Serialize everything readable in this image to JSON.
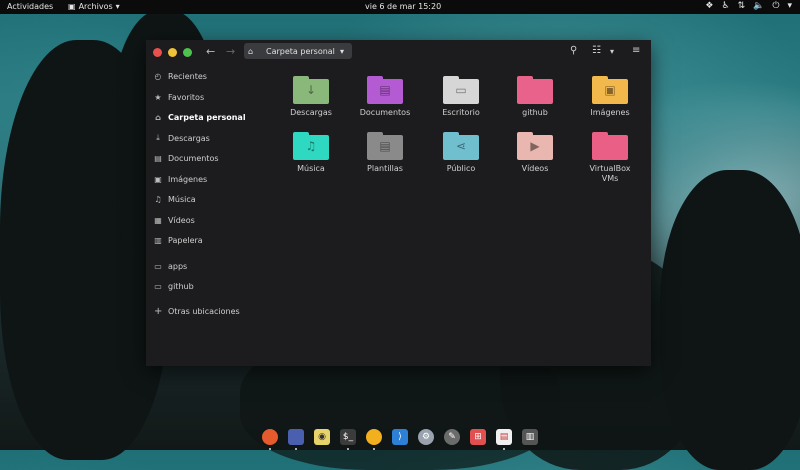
{
  "topbar": {
    "activities": "Actividades",
    "app_menu": "Archivos",
    "clock": "vie 6 de mar  15:20"
  },
  "window": {
    "path_label": "Carpeta personal",
    "colors": {
      "close": "#e9514c",
      "minimize": "#f0c23a",
      "maximize": "#4ec24c"
    }
  },
  "sidebar": {
    "items": [
      {
        "label": "Recientes",
        "icon": "clock-icon"
      },
      {
        "label": "Favoritos",
        "icon": "star-icon"
      },
      {
        "label": "Carpeta personal",
        "icon": "home-icon"
      },
      {
        "label": "Descargas",
        "icon": "download-icon"
      },
      {
        "label": "Documentos",
        "icon": "document-icon"
      },
      {
        "label": "Imágenes",
        "icon": "image-icon"
      },
      {
        "label": "Música",
        "icon": "music-icon"
      },
      {
        "label": "Vídeos",
        "icon": "video-icon"
      },
      {
        "label": "Papelera",
        "icon": "trash-icon"
      },
      {
        "label": "apps",
        "icon": "folder-icon"
      },
      {
        "label": "github",
        "icon": "folder-icon"
      },
      {
        "label": "Otras ubicaciones",
        "icon": "plus-icon"
      }
    ]
  },
  "files": [
    {
      "label": "Descargas",
      "color": "#8ab87a",
      "icon": "download-icon"
    },
    {
      "label": "Documentos",
      "color": "#b45bd4",
      "icon": "document-icon"
    },
    {
      "label": "Escritorio",
      "color": "#d6d6d6",
      "icon": "monitor-icon"
    },
    {
      "label": "github",
      "color": "#e8628c",
      "icon": "folder-icon"
    },
    {
      "label": "Imágenes",
      "color": "#f2b84b",
      "icon": "image-icon"
    },
    {
      "label": "Música",
      "color": "#2fd8c0",
      "icon": "music-icon"
    },
    {
      "label": "Plantillas",
      "color": "#8a8a8a",
      "icon": "template-icon"
    },
    {
      "label": "Público",
      "color": "#6fbfcf",
      "icon": "share-icon"
    },
    {
      "label": "Vídeos",
      "color": "#e9b6b0",
      "icon": "video-icon"
    },
    {
      "label": "VirtualBox VMs",
      "color": "#ea5f86",
      "icon": "folder-icon"
    }
  ],
  "dock": [
    {
      "icon": "firefox-icon",
      "color": "#e55b2d",
      "running": true
    },
    {
      "icon": "files-icon",
      "color": "#4a5fae",
      "running": true
    },
    {
      "icon": "rhythmbox-icon",
      "color": "#e8d36a",
      "running": false
    },
    {
      "icon": "terminal-icon",
      "color": "#3b3b3b",
      "running": true
    },
    {
      "icon": "chrome-icon",
      "color": "#f2b01e",
      "running": true
    },
    {
      "icon": "vscode-icon",
      "color": "#2e7fd6",
      "running": false
    },
    {
      "icon": "settings-icon",
      "color": "#9aa3ad",
      "running": false
    },
    {
      "icon": "gimp-icon",
      "color": "#6b6b6b",
      "running": false
    },
    {
      "icon": "app-grid-icon",
      "color": "#e05050",
      "running": false
    },
    {
      "icon": "text-editor-icon",
      "color": "#f0f0f0",
      "running": true
    },
    {
      "icon": "trash-icon",
      "color": "#555555",
      "running": false
    }
  ]
}
